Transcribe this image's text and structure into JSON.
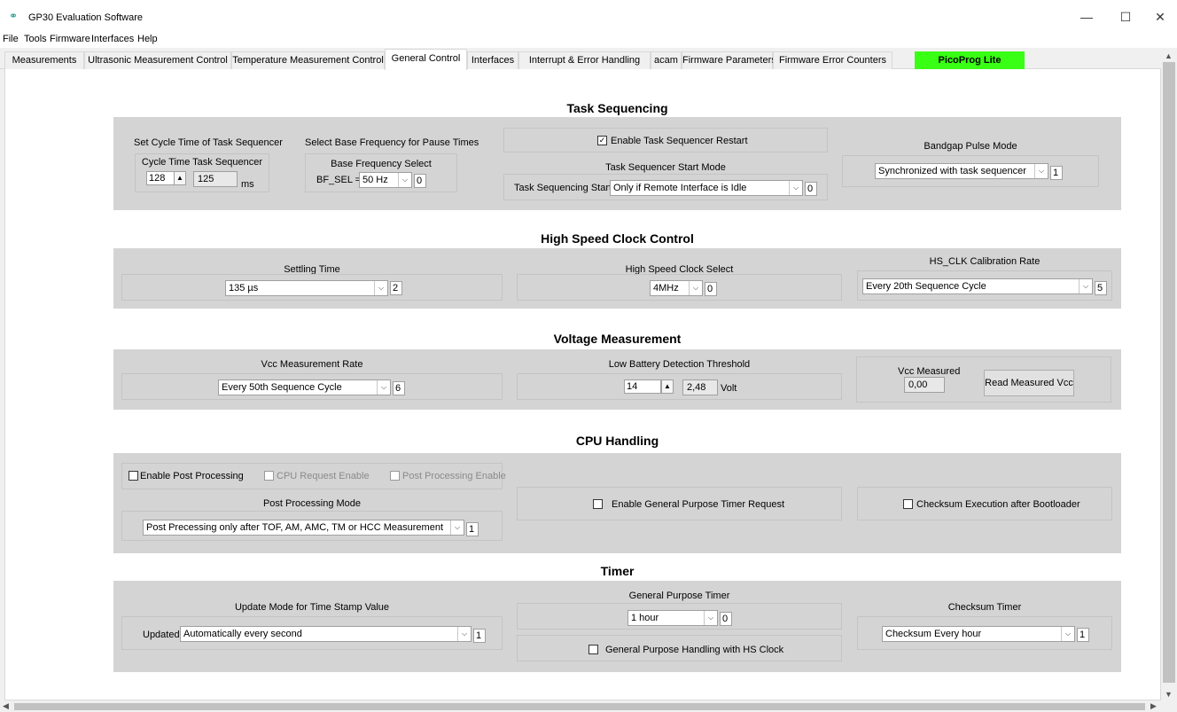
{
  "window": {
    "title": "GP30 Evaluation Software",
    "minimize": "—",
    "maximize": "☐",
    "close": "✕"
  },
  "menu": [
    "File",
    "Tools",
    "Firmware",
    "Interfaces",
    "Help"
  ],
  "tabs": [
    "Measurements",
    "Ultrasonic Measurement Control",
    "Temperature Measurement Control",
    "General Control",
    "Interfaces",
    "Interrupt & Error Handling",
    "acam",
    "Firmware Parameters",
    "Firmware Error Counters",
    "PicoProg Lite"
  ],
  "active_tab": "General Control",
  "colors": {
    "picoprog_bg": "#39ff14",
    "panel": "#d4d4d4"
  },
  "task": {
    "title": "Task Sequencing",
    "cycle_header": "Set Cycle Time of Task Sequencer",
    "cycle_label": "Cycle Time Task Sequencer",
    "cycle_value": "128",
    "cycle_ms_value": "125",
    "cycle_unit": "ms",
    "base_header": "Select Base Frequency for Pause Times",
    "base_label": "Base Frequency Select",
    "bf_prefix": "BF_SEL =",
    "bf_value": "50 Hz",
    "bf_code": "0",
    "restart_label": "Enable Task Sequencer Restart",
    "restart_checked": true,
    "start_mode_label": "Task Sequencer Start Mode",
    "start_prefix": "Task Sequencing Starts:",
    "start_value": "Only if Remote Interface is Idle",
    "start_code": "0",
    "bandgap_label": "Bandgap Pulse Mode",
    "bandgap_value": "Synchronized with task sequencer",
    "bandgap_code": "1"
  },
  "hsclk": {
    "title": "High Speed Clock Control",
    "settling_label": "Settling Time",
    "settling_value": "135 µs",
    "settling_code": "2",
    "select_label": "High Speed Clock Select",
    "select_value": "4MHz",
    "select_code": "0",
    "calib_label": "HS_CLK Calibration Rate",
    "calib_value": "Every 20th Sequence Cycle",
    "calib_code": "5"
  },
  "voltage": {
    "title": "Voltage Measurement",
    "rate_label": "Vcc Measurement Rate",
    "rate_value": "Every 50th Sequence Cycle",
    "rate_code": "6",
    "lowbat_label": "Low Battery Detection Threshold",
    "lowbat_value": "14",
    "lowbat_volt": "2,48",
    "lowbat_unit": "Volt",
    "vcc_label": "Vcc Measured",
    "vcc_value": "0,00",
    "read_button": "Read Measured Vcc"
  },
  "cpu": {
    "title": "CPU Handling",
    "post_enable": "Enable Post Processing",
    "cpu_req": "CPU Request Enable",
    "post_proc_enable": "Post Processing Enable",
    "mode_label": "Post Processing Mode",
    "mode_value": "Post Precessing only after TOF, AM, AMC, TM or HCC Measurement",
    "mode_code": "1",
    "gp_timer_req": "Enable General Purpose Timer Request",
    "checksum_boot": "Checksum Execution after Bootloader"
  },
  "timer": {
    "title": "Timer",
    "update_label": "Update Mode for Time Stamp Value",
    "update_prefix": "Updated",
    "update_value": "Automatically every second",
    "update_code": "1",
    "gp_label": "General Purpose Timer",
    "gp_value": "1 hour",
    "gp_code": "0",
    "gp_hs_label": "General Purpose Handling with HS Clock",
    "checksum_label": "Checksum Timer",
    "checksum_value": "Checksum Every hour",
    "checksum_code": "1"
  }
}
